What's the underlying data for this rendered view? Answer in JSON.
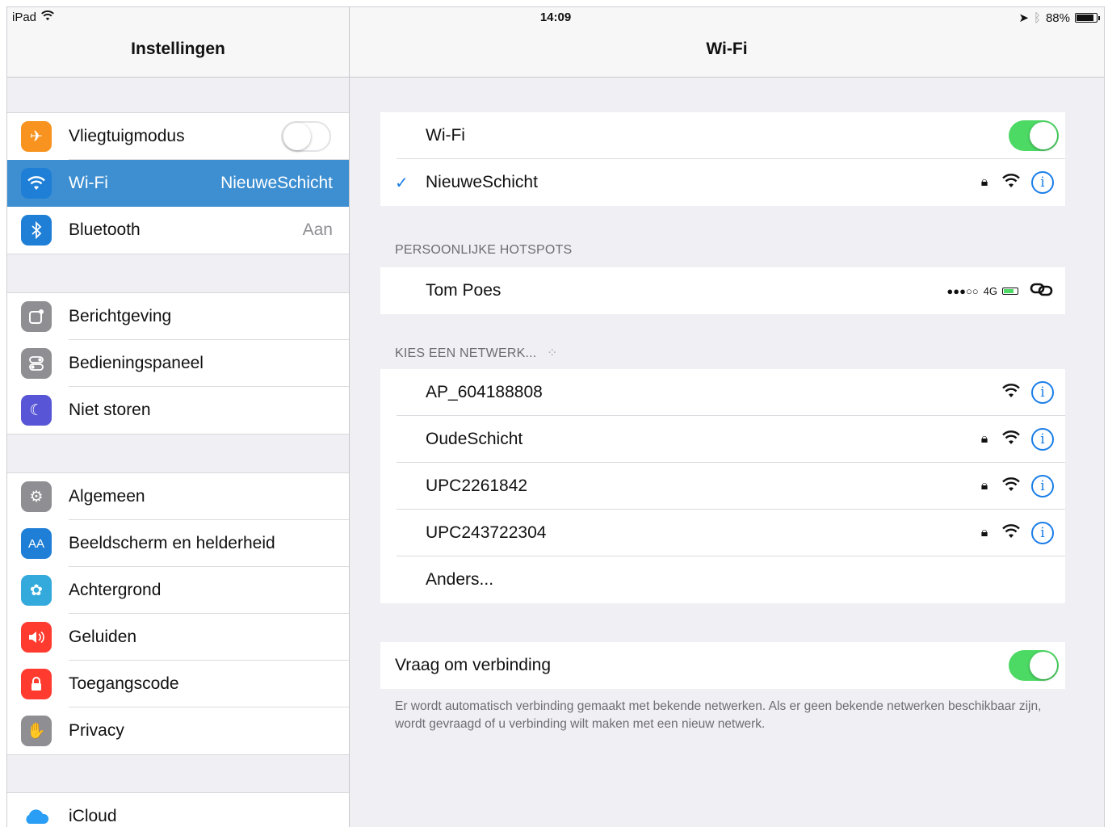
{
  "status_bar": {
    "device": "iPad",
    "time": "14:09",
    "battery_text": "88%",
    "battery_level": 0.88
  },
  "sidebar": {
    "title": "Instellingen",
    "groups": [
      {
        "items": [
          {
            "icon": "airplane-icon",
            "label": "Vliegtuigmodus",
            "color": "#f7931e",
            "toggle": false
          },
          {
            "icon": "wifi-icon",
            "label": "Wi-Fi",
            "value": "NieuweSchicht",
            "color": "#1f7fd6",
            "selected": true
          },
          {
            "icon": "bluetooth-icon",
            "label": "Bluetooth",
            "value": "Aan",
            "color": "#1f7fd6"
          }
        ]
      },
      {
        "items": [
          {
            "icon": "notifications-icon",
            "label": "Berichtgeving",
            "color": "#8e8e93"
          },
          {
            "icon": "control-center-icon",
            "label": "Bedieningspaneel",
            "color": "#8e8e93"
          },
          {
            "icon": "moon-icon",
            "label": "Niet storen",
            "color": "#5856d6"
          }
        ]
      },
      {
        "items": [
          {
            "icon": "gear-icon",
            "label": "Algemeen",
            "color": "#8e8e93"
          },
          {
            "icon": "display-icon",
            "label": "Beeldscherm en helderheid",
            "color": "#1f7fd6"
          },
          {
            "icon": "wallpaper-icon",
            "label": "Achtergrond",
            "color": "#34aadc"
          },
          {
            "icon": "sound-icon",
            "label": "Geluiden",
            "color": "#ff3b30"
          },
          {
            "icon": "passcode-lock-icon",
            "label": "Toegangscode",
            "color": "#ff3b30"
          },
          {
            "icon": "privacy-hand-icon",
            "label": "Privacy",
            "color": "#8e8e93"
          }
        ]
      },
      {
        "items": [
          {
            "icon": "cloud-icon",
            "label": "iCloud",
            "color": "#ffffff"
          }
        ]
      }
    ]
  },
  "detail": {
    "title": "Wi-Fi",
    "wifi_label": "Wi-Fi",
    "wifi_on": true,
    "connected_network": "NieuweSchicht",
    "hotspots_header": "PERSOONLIJKE HOTSPOTS",
    "hotspot": {
      "name": "Tom Poes",
      "signal": "●●●○○",
      "network_type": "4G"
    },
    "choose_header": "KIES EEN NETWERK...",
    "networks": [
      {
        "name": "AP_604188808",
        "locked": false
      },
      {
        "name": "OudeSchicht",
        "locked": true
      },
      {
        "name": "UPC2261842",
        "locked": true
      },
      {
        "name": "UPC243722304",
        "locked": true
      }
    ],
    "other_label": "Anders...",
    "ask_to_join_label": "Vraag om verbinding",
    "ask_to_join_on": true,
    "footnote": "Er wordt automatisch verbinding gemaakt met bekende netwerken. Als er geen bekende netwerken beschikbaar zijn, wordt gevraagd of u verbinding wilt maken met een nieuw netwerk."
  }
}
